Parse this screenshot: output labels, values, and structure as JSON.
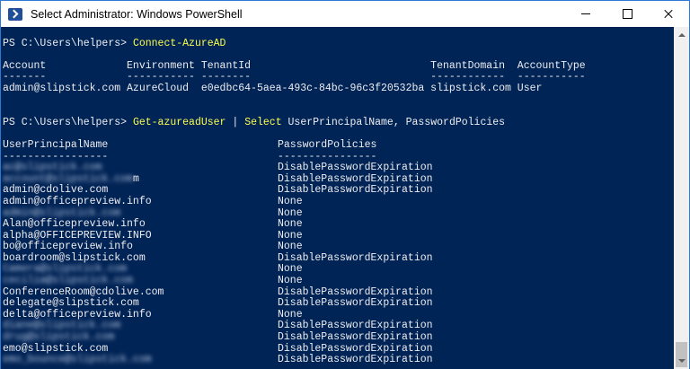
{
  "window": {
    "title": "Select Administrator: Windows PowerShell"
  },
  "colors": {
    "console_bg": "#012456",
    "console_fg": "#eeedf0",
    "command": "#fdfd4f",
    "accent_border": "#2b7bd6"
  },
  "icons": {
    "app": "powershell-icon",
    "minimize": "minimize-icon",
    "maximize": "maximize-icon",
    "close": "close-icon"
  },
  "console": {
    "prompt1": "PS C:\\Users\\helpers> ",
    "cmd1": "Connect-AzureAD",
    "header1": "Account             Environment TenantId                             TenantDomain  AccountType",
    "dash1": "-------             ----------- --------                             ------------  -----------",
    "row1": "admin@slipstick.com AzureCloud  e0edbc64-5aea-493c-84bc-96c3f20532ba slipstick.com User",
    "prompt2": "PS C:\\Users\\helpers> ",
    "cmd2a": "Get-azureadUser",
    "pipe": " | ",
    "cmd2b": "Select",
    "args2": " UserPrincipalName, PasswordPolicies",
    "col_header": {
      "upn": "UserPrincipalName",
      "policies": "PasswordPolicies"
    },
    "col_dash": {
      "upn": "-----------------",
      "policies": "----------------"
    },
    "users": [
      {
        "upn": "ac@slipstick.com",
        "policy": "DisablePasswordExpiration",
        "blurred": true
      },
      {
        "upn": "account@slipstick.com",
        "visible_tail": "m",
        "policy": "DisablePasswordExpiration",
        "blurred": true
      },
      {
        "upn": "admin@cdolive.com",
        "policy": "DisablePasswordExpiration",
        "blurred": false
      },
      {
        "upn": "admin@officepreview.info",
        "policy": "None",
        "blurred": false
      },
      {
        "upn": "admin@slipstick.com",
        "policy": "None",
        "blurred": true
      },
      {
        "upn": "Alan@officepreview.info",
        "policy": "None",
        "blurred": false
      },
      {
        "upn": "alpha@OFFICEPREVIEW.INFO",
        "policy": "None",
        "blurred": false
      },
      {
        "upn": "bo@officepreview.info",
        "policy": "None",
        "blurred": false
      },
      {
        "upn": "boardroom@slipstick.com",
        "policy": "DisablePasswordExpiration",
        "blurred": false
      },
      {
        "upn": "Camera@slipstick.com",
        "policy": "None",
        "blurred": true
      },
      {
        "upn": "cecilia@slipstick.com",
        "policy": "None",
        "blurred": true
      },
      {
        "upn": "ConferenceRoom@cdolive.com",
        "policy": "DisablePasswordExpiration",
        "blurred": false
      },
      {
        "upn": "delegate@slipstick.com",
        "policy": "DisablePasswordExpiration",
        "blurred": false
      },
      {
        "upn": "delta@officepreview.info",
        "policy": "None",
        "blurred": false
      },
      {
        "upn": "diane@slipstick.com",
        "policy": "DisablePasswordExpiration",
        "blurred": true
      },
      {
        "upn": "drug@slipstick.com",
        "policy": "DisablePasswordExpiration",
        "blurred": true
      },
      {
        "upn": "emo@slipstick.com",
        "policy": "DisablePasswordExpiration",
        "blurred": false
      },
      {
        "upn": "emo_bounce@slipstick.com",
        "policy": "DisablePasswordExpiration",
        "blurred": true
      }
    ]
  }
}
